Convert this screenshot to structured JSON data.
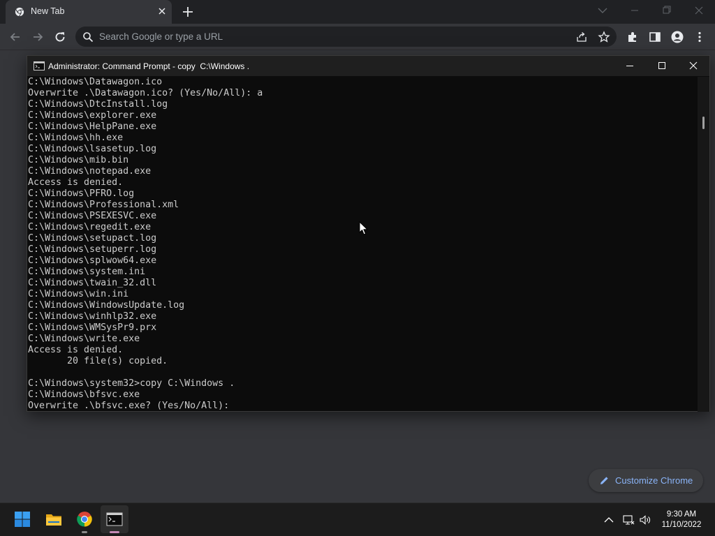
{
  "browser": {
    "tab_title": "New Tab",
    "omnibox_placeholder": "Search Google or type a URL",
    "customize_label": "Customize Chrome"
  },
  "cmd_window": {
    "title": "Administrator: Command Prompt - copy  C:\\Windows .",
    "lines": [
      "C:\\Windows\\Datawagon.ico",
      "Overwrite .\\Datawagon.ico? (Yes/No/All): a",
      "C:\\Windows\\DtcInstall.log",
      "C:\\Windows\\explorer.exe",
      "C:\\Windows\\HelpPane.exe",
      "C:\\Windows\\hh.exe",
      "C:\\Windows\\lsasetup.log",
      "C:\\Windows\\mib.bin",
      "C:\\Windows\\notepad.exe",
      "Access is denied.",
      "C:\\Windows\\PFRO.log",
      "C:\\Windows\\Professional.xml",
      "C:\\Windows\\PSEXESVC.exe",
      "C:\\Windows\\regedit.exe",
      "C:\\Windows\\setupact.log",
      "C:\\Windows\\setuperr.log",
      "C:\\Windows\\splwow64.exe",
      "C:\\Windows\\system.ini",
      "C:\\Windows\\twain_32.dll",
      "C:\\Windows\\win.ini",
      "C:\\Windows\\WindowsUpdate.log",
      "C:\\Windows\\winhlp32.exe",
      "C:\\Windows\\WMSysPr9.prx",
      "C:\\Windows\\write.exe",
      "Access is denied.",
      "       20 file(s) copied.",
      "",
      "C:\\Windows\\system32>copy C:\\Windows .",
      "C:\\Windows\\bfsvc.exe",
      "Overwrite .\\bfsvc.exe? (Yes/No/All):"
    ]
  },
  "taskbar": {
    "apps": [
      {
        "name": "start-button",
        "icon": "windows-logo-icon"
      },
      {
        "name": "file-explorer",
        "icon": "folder-icon"
      },
      {
        "name": "chrome",
        "icon": "chrome-icon"
      },
      {
        "name": "command-prompt",
        "icon": "terminal-icon"
      }
    ],
    "time": "9:30 AM",
    "date": "11/10/2022"
  },
  "colors": {
    "chrome_frame": "#202124",
    "chrome_toolbar": "#35363a",
    "console_bg": "#0c0c0c",
    "console_text": "#cccccc",
    "accent_blue": "#8ab4f8",
    "taskbar_bg": "#1c1c1c"
  }
}
